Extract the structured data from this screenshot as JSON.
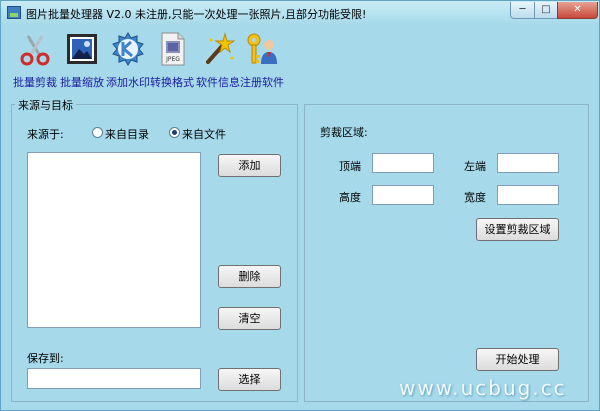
{
  "window": {
    "title": "图片批量处理器 V2.0  未注册,只能一次处理一张照片,且部分功能受限!",
    "controls": {
      "minimize": "─",
      "maximize": "□",
      "close": "✕"
    }
  },
  "toolbar": [
    {
      "label": "批量剪裁",
      "icon": "scissors-icon"
    },
    {
      "label": "批量缩放",
      "icon": "picture-icon"
    },
    {
      "label": "添加水印",
      "icon": "k-logo-icon"
    },
    {
      "label": "转换格式",
      "icon": "jpeg-file-icon",
      "icon_text": "JPEG"
    },
    {
      "label": "软件信息",
      "icon": "magic-wand-icon"
    },
    {
      "label": "注册软件",
      "icon": "key-user-icon"
    }
  ],
  "source_panel": {
    "legend": "来源与目标",
    "source_label": "来源于:",
    "options": [
      {
        "label": "来自目录",
        "checked": false
      },
      {
        "label": "来自文件",
        "checked": true
      }
    ],
    "add_button": "添加",
    "delete_button": "删除",
    "clear_button": "清空",
    "save_label": "保存到:",
    "save_value": "",
    "browse_button": "选择"
  },
  "crop_panel": {
    "title": "剪裁区域:",
    "fields": {
      "top_label": "顶端",
      "top_value": "",
      "left_label": "左端",
      "left_value": "",
      "height_label": "高度",
      "height_value": "",
      "width_label": "宽度",
      "width_value": ""
    },
    "set_region_button": "设置剪裁区域",
    "start_button": "开始处理"
  },
  "watermark": "www.ucbug.cc"
}
